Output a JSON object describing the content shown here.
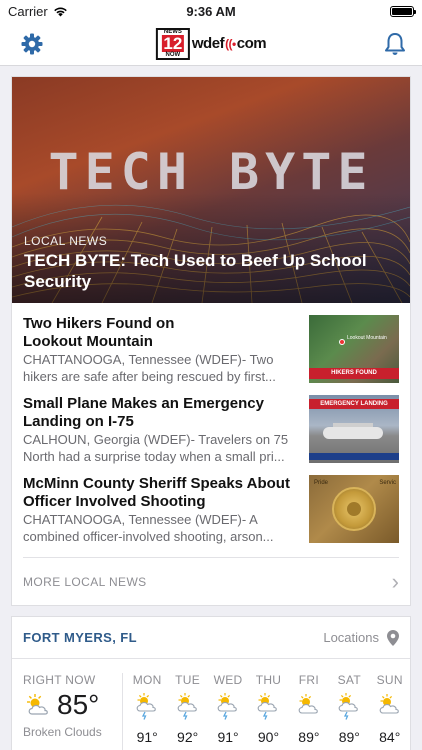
{
  "status": {
    "carrier": "Carrier",
    "time": "9:36 AM"
  },
  "nav": {
    "logo_badge_top": "NEWS",
    "logo_badge_num": "12",
    "logo_badge_bottom": "NOW",
    "logo_text_left": "wdef",
    "logo_text_right": "com"
  },
  "hero": {
    "brand": "TECH BYTE",
    "kicker": "LOCAL NEWS",
    "title": "TECH BYTE: Tech Used to Beef Up School Security"
  },
  "stories": [
    {
      "title": "Two Hikers Found on Lookout Mountain",
      "desc_line1": "CHATTANOOGA, Tennessee (WDEF)- Two",
      "desc_line2": "hikers are safe after being rescued by first...",
      "thumb_label": "Lookout Mountain",
      "thumb_bar": "HIKERS FOUND"
    },
    {
      "title": "Small Plane Makes an Emergency Landing on I-75",
      "desc_line1": "CALHOUN, Georgia (WDEF)- Travelers on 75",
      "desc_line2": "North had a surprise today when a small pri...",
      "thumb_bar": "EMERGENCY LANDING"
    },
    {
      "title": "McMinn County Sheriff Speaks About Officer Involved Shooting",
      "desc_line1": "CHATTANOOGA, Tennessee (WDEF)- A",
      "desc_line2": "combined officer-involved shooting, arson...",
      "thumb_t1": "Pride",
      "thumb_t2": "Servic"
    }
  ],
  "more": {
    "label": "MORE LOCAL NEWS"
  },
  "weather": {
    "location": "FORT MYERS, FL",
    "locations_label": "Locations",
    "now_label": "RIGHT NOW",
    "now_temp": "85°",
    "now_cond": "Broken Clouds",
    "days": [
      {
        "name": "MON",
        "temp": "91°",
        "icon": "storm-icon"
      },
      {
        "name": "TUE",
        "temp": "92°",
        "icon": "storm-icon"
      },
      {
        "name": "WED",
        "temp": "91°",
        "icon": "storm-icon"
      },
      {
        "name": "THU",
        "temp": "90°",
        "icon": "storm-icon"
      },
      {
        "name": "FRI",
        "temp": "89°",
        "icon": "partly-cloudy-icon"
      },
      {
        "name": "SAT",
        "temp": "89°",
        "icon": "storm-icon"
      },
      {
        "name": "SUN",
        "temp": "84°",
        "icon": "partly-cloudy-icon"
      }
    ]
  },
  "colors": {
    "accent": "#2f6aa8",
    "link": "#2f5b8a",
    "brand_red": "#d81e2b"
  }
}
